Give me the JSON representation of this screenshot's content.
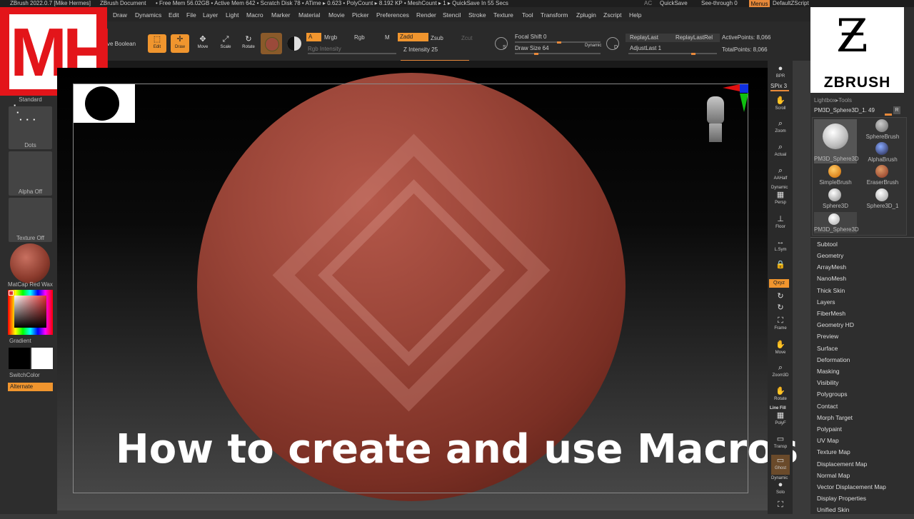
{
  "titlebar": {
    "app": "ZBrush 2022.0.7 [Mike Hermes]",
    "document": "ZBrush Document",
    "stats": "• Free Mem 56.02GB • Active Mem 642 • Scratch Disk 78 •  ATime ▸ 0.623 • PolyCount ▸ 8.192 KP  • MeshCount ▸ 1   ▸ QuickSave In 55 Secs",
    "ac": "AC",
    "quicksave": "QuickSave",
    "seethrough": "See-through  0",
    "menus": "Menus",
    "script": "DefaultZScript"
  },
  "menubar": {
    "items": [
      "Draw",
      "Dynamics",
      "Edit",
      "File",
      "Layer",
      "Light",
      "Macro",
      "Marker",
      "Material",
      "Movie",
      "Picker",
      "Preferences",
      "Render",
      "Stencil",
      "Stroke",
      "Texture",
      "Tool",
      "Transform",
      "Zplugin",
      "Zscript",
      "Help"
    ]
  },
  "logo": {
    "text": "MH"
  },
  "toolbar": {
    "live_boolean": "ve Boolean",
    "edit": "Edit",
    "draw": "Draw",
    "move": "Move",
    "scale": "Scale",
    "rotate": "Rotate",
    "a": "A",
    "mrgb": "Mrgb",
    "rgb": "Rgb",
    "m": "M",
    "zadd": "Zadd",
    "zsub": "Zsub",
    "zcut": "Zcut",
    "rgb_intensity": "Rgb Intensity",
    "z_intensity": "Z Intensity 25",
    "s_label": "S",
    "d_label": "D",
    "focal_shift": "Focal Shift 0",
    "draw_size": "Draw Size 64",
    "dynamic": "Dynamic",
    "replay_last": "ReplayLast",
    "replay_last_rel": "ReplayLastRel",
    "adjust_last": "AdjustLast 1",
    "active_points": "ActivePoints: 8,066",
    "total_points": "TotalPoints: 8,066"
  },
  "leftpanel": {
    "standard": "Standard",
    "dots": "Dots",
    "alpha_off": "Alpha Off",
    "texture_off": "Texture Off",
    "material": "MatCap Red Wax",
    "gradient": "Gradient",
    "switch_color": "SwitchColor",
    "alternate": "Alternate"
  },
  "rightshelf": {
    "bpr": "BPR",
    "spix": "SPix 3",
    "scroll": "Scroll",
    "zoom": "Zoom",
    "actual": "Actual",
    "aahalf": "AAHalf",
    "dynamic": "Dynamic",
    "persp": "Persp",
    "floor": "Floor",
    "lsym": "L.Sym",
    "xyz": "Qxyz",
    "frame": "Frame",
    "move": "Move",
    "zoom3d": "Zoom3D",
    "rotate": "Rotate",
    "line_fill": "Line Fill",
    "polyf": "PolyF",
    "transp": "Transp",
    "ghost": "Ghost",
    "dynamic2": "Dynamic",
    "solo": "Solo"
  },
  "palette": {
    "zbrush_logo": "ZBRUSH",
    "lightbox_tools": "Lightbox▸Tools",
    "current_tool": "PM3D_Sphere3D_1. 49",
    "r": "R",
    "thumbs": [
      {
        "label": "PM3D_Sphere3D"
      },
      {
        "label": "SphereBrush"
      },
      {
        "label": "AlphaBrush"
      },
      {
        "label": "SimpleBrush"
      },
      {
        "label": "EraserBrush"
      },
      {
        "label": "Sphere3D"
      },
      {
        "label": "Sphere3D_1"
      },
      {
        "label": "PM3D_Sphere3D"
      }
    ],
    "subpalettes": [
      "Subtool",
      "Geometry",
      "ArrayMesh",
      "NanoMesh",
      "Thick Skin",
      "Layers",
      "FiberMesh",
      "Geometry HD",
      "Preview",
      "Surface",
      "Deformation",
      "Masking",
      "Visibility",
      "Polygroups",
      "Contact",
      "Morph Target",
      "Polypaint",
      "UV Map",
      "Texture Map",
      "Displacement Map",
      "Normal Map",
      "Vector Displacement Map",
      "Display Properties",
      "Unified Skin"
    ]
  },
  "caption": "How to create and use Macros"
}
